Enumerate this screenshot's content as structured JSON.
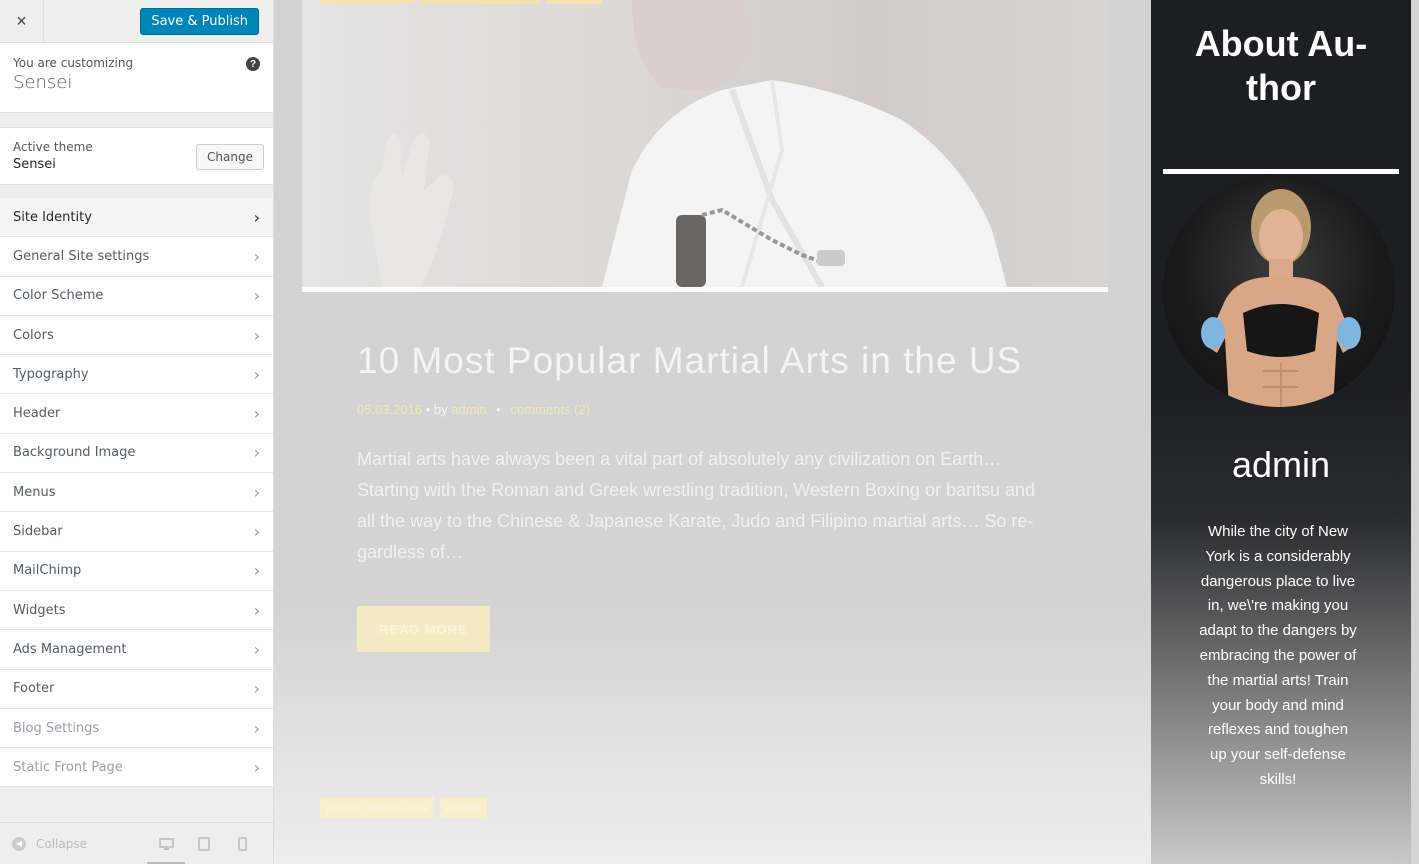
{
  "customizer": {
    "close_label": "×",
    "save_label": "Save & Publish",
    "info": {
      "pre_label": "You are customizing",
      "site_name": "Sensei",
      "help_icon": "?"
    },
    "theme": {
      "label": "Active theme",
      "name": "Sensei",
      "change_label": "Change"
    },
    "sections": [
      {
        "label": "Site Identity"
      },
      {
        "label": "General Site settings"
      },
      {
        "label": "Color Scheme"
      },
      {
        "label": "Colors"
      },
      {
        "label": "Typography"
      },
      {
        "label": "Header"
      },
      {
        "label": "Background Image"
      },
      {
        "label": "Menus"
      },
      {
        "label": "Sidebar"
      },
      {
        "label": "MailChimp"
      },
      {
        "label": "Widgets"
      },
      {
        "label": "Ads Management"
      },
      {
        "label": "Footer"
      },
      {
        "label": "Blog Settings"
      },
      {
        "label": "Static Front Page"
      }
    ],
    "footer": {
      "collapse_label": "Collapse"
    }
  },
  "preview": {
    "post": {
      "title": "10 Most Popular Martial Arts in the US",
      "date": "05.03.2016",
      "by": "• by",
      "author": "admin",
      "sep": "•",
      "comments": "comments (2)",
      "excerpt": "Martial arts have always been a vital part of absolutely any civilization on Earth… Starting with the Roman and Greek wrestling tradition, Western Boxing or baritsu and all the way to the Chinese & Japanese Karate, Judo and Filipino martial arts… So re-gardless of…",
      "read_more": "READ MORE"
    },
    "bottom_tags": [
      "Filipino Martial Arts",
      "Karate"
    ]
  },
  "about": {
    "title_line1": "About Au-",
    "title_line2": "thor",
    "name": "admin",
    "bio": "While the city of New York is a considerably dangerous place to live in, we\\'re making you adapt to the dangers by embracing the power of the martial arts! Train your body and mind reflexes and toughen up your self-defense skills!"
  },
  "colors": {
    "primary_button": "#0085ba",
    "accent_yellow": "#f3e5b6",
    "sidebar_bg": "#1d1e22"
  }
}
